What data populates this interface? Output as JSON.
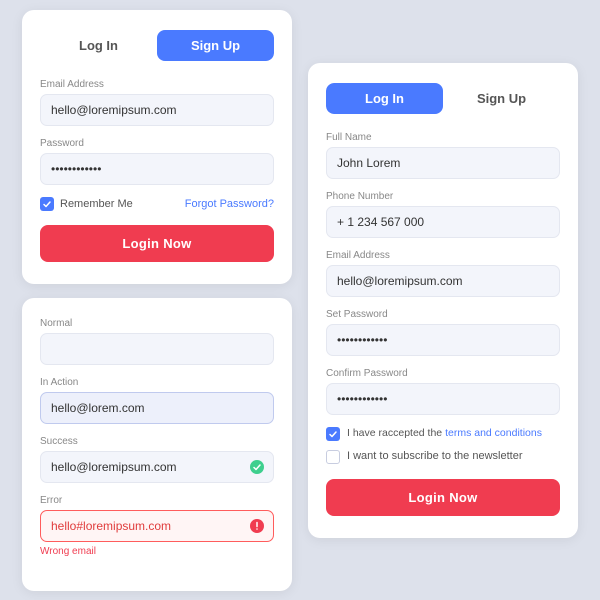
{
  "left_top": {
    "tab_login": "Log In",
    "tab_signup": "Sign Up",
    "email_label": "Email Address",
    "email_value": "hello@loremipsum.com",
    "password_label": "Password",
    "password_value": "••••••••••••",
    "remember_label": "Remember Me",
    "forgot_label": "Forgot Password?",
    "login_btn": "Login Now"
  },
  "left_bottom": {
    "normal_label": "Normal",
    "normal_value": "",
    "in_action_label": "In Action",
    "in_action_value": "hello@lorem.com",
    "success_label": "Success",
    "success_value": "hello@loremipsum.com",
    "error_label": "Error",
    "error_value": "hello#loremipsum.com",
    "error_msg": "Wrong email"
  },
  "right": {
    "tab_login": "Log In",
    "tab_signup": "Sign Up",
    "fullname_label": "Full Name",
    "fullname_value": "John Lorem",
    "phone_label": "Phone Number",
    "phone_value": "+ 1 234 567 000",
    "email_label": "Email Address",
    "email_value": "hello@loremipsum.com",
    "setpass_label": "Set Password",
    "setpass_value": "••••••••••••",
    "confirmpass_label": "Confirm Password",
    "confirmpass_value": "••••••••••••",
    "terms_text1": "I have raccepted the ",
    "terms_link": "terms and conditions",
    "newsletter_label": "I want to subscribe to the newsletter",
    "login_btn": "Login Now"
  },
  "colors": {
    "accent_blue": "#4a7aff",
    "accent_red": "#f03c50",
    "bg": "#dde1eb"
  }
}
